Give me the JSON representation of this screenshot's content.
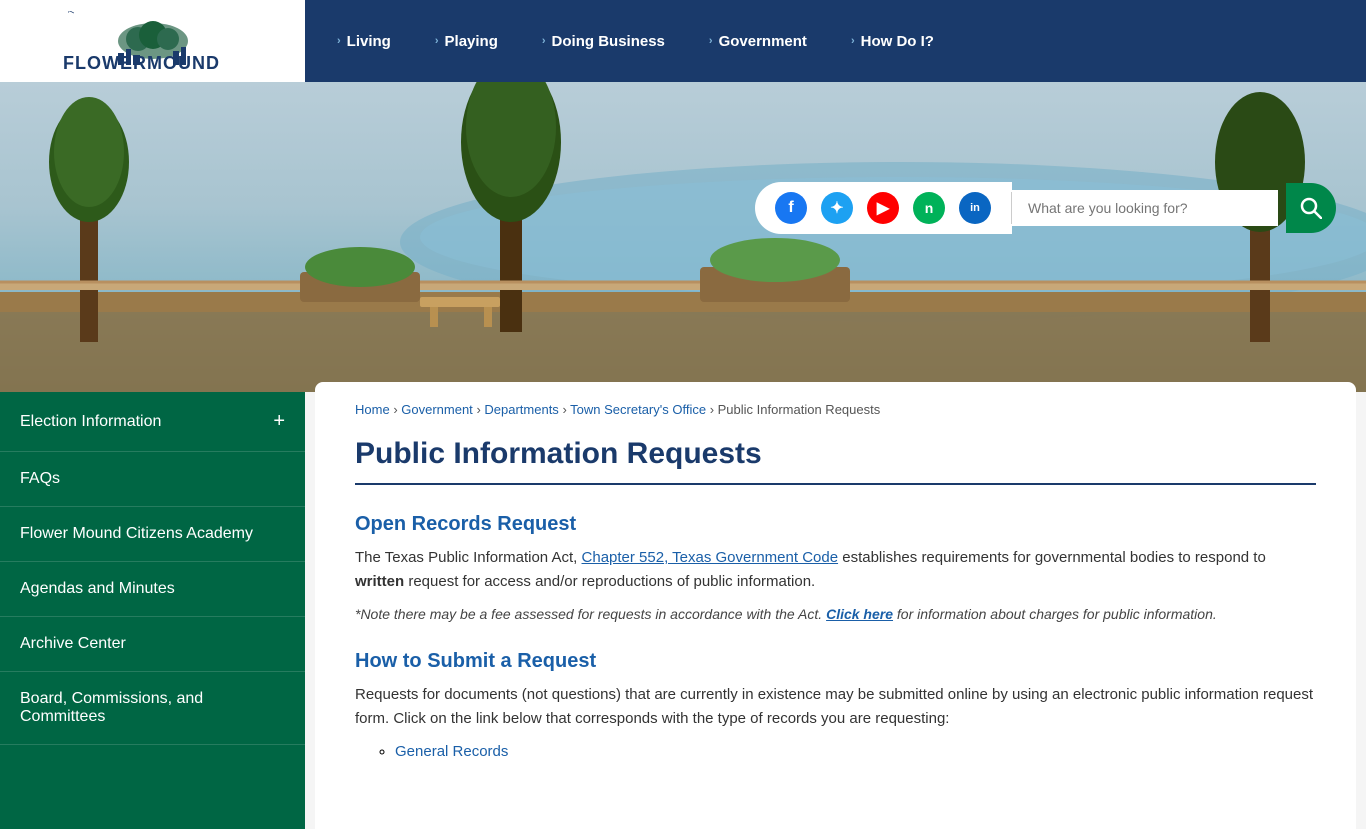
{
  "header": {
    "logo_alt": "The Town of Flower Mound Texas",
    "nav_items": [
      {
        "label": "Living",
        "id": "living"
      },
      {
        "label": "Playing",
        "id": "playing"
      },
      {
        "label": "Doing Business",
        "id": "doing-business"
      },
      {
        "label": "Government",
        "id": "government"
      },
      {
        "label": "How Do I?",
        "id": "how-do-i"
      }
    ]
  },
  "search": {
    "placeholder": "What are you looking for?",
    "button_label": "🔍"
  },
  "social": {
    "facebook": "f",
    "twitter": "t",
    "youtube": "▶",
    "nextdoor": "n",
    "linkedin": "in"
  },
  "breadcrumb": {
    "items": [
      {
        "label": "Home",
        "href": "#"
      },
      {
        "label": "Government",
        "href": "#"
      },
      {
        "label": "Departments",
        "href": "#"
      },
      {
        "label": "Town Secretary's Office",
        "href": "#"
      },
      {
        "label": "Public Information Requests",
        "href": "#",
        "current": true
      }
    ]
  },
  "sidebar": {
    "items": [
      {
        "label": "Election Information",
        "id": "election-information",
        "has_plus": true
      },
      {
        "label": "FAQs",
        "id": "faqs",
        "has_plus": false
      },
      {
        "label": "Flower Mound Citizens Academy",
        "id": "flower-mound-citizens-academy",
        "has_plus": false
      },
      {
        "label": "Agendas and Minutes",
        "id": "agendas-and-minutes",
        "has_plus": false
      },
      {
        "label": "Archive Center",
        "id": "archive-center",
        "has_plus": false
      },
      {
        "label": "Board, Commissions, and Committees",
        "id": "board-commissions-committees",
        "has_plus": false
      }
    ]
  },
  "page": {
    "title": "Public Information Requests",
    "sections": [
      {
        "id": "open-records",
        "heading": "Open Records Request",
        "paragraph": "The Texas Public Information Act, ",
        "link_text": "Chapter 552, Texas Government Code",
        "link_href": "#",
        "paragraph_after": " establishes requirements for governmental bodies to respond to ",
        "bold_word": "written",
        "paragraph_end": " request for access and/or reproductions of public information.",
        "note": "*Note there may be a fee assessed for requests in accordance with the Act. ",
        "note_link": "Click here",
        "note_link_href": "#",
        "note_end": " for information about charges for public information."
      },
      {
        "id": "how-to-submit",
        "heading": "How to Submit a Request",
        "paragraph": "Requests for documents (not questions) that are currently in existence may be submitted online by using an electronic public information request form. Click on the link below that corresponds with the type of records you are requesting:",
        "list_items": [
          {
            "label": "General Records",
            "href": "#"
          }
        ]
      }
    ]
  }
}
